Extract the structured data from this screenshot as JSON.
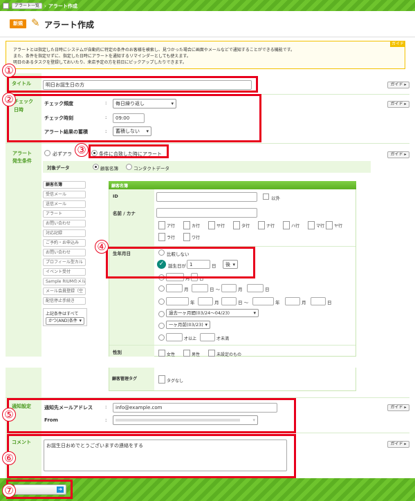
{
  "breadcrumb": {
    "home": "アラート一覧",
    "current": "アラート作成"
  },
  "header": {
    "badge": "新規",
    "title": "アラート作成"
  },
  "info": {
    "guide": "ガイド",
    "lines": [
      "アラートとは指定した日時にシステムが自動的に特定の条件のお客様を検索し、見つかった場合に画面やメールなどで通知することができる機能です。",
      "また、条件を指定せずに、指定した日時にアラートを通知するリマインダーとしても使えます。",
      "明日のあるタスクを登録しておいたり、来店予定の方を前日にピックアップしたりできます。"
    ]
  },
  "guide_label": "ガイド ▸",
  "title_section": {
    "label": "タイトル",
    "value": "明日お誕生日の方"
  },
  "check_section": {
    "label1": "チェック",
    "label2": "日時",
    "freq_label": "チェック頻度",
    "freq_value": "毎日繰り返し",
    "time_label": "チェック時刻",
    "time_value": "09:00",
    "store_label": "アラート結果の蓄積",
    "store_value": "蓄積しない"
  },
  "condition_section": {
    "label1": "アラート",
    "label2": "発生条件",
    "opt_always": "必ずアラ",
    "opt_match": "条件に合致した時にアラート",
    "target_label": "対象データ",
    "target_customer": "顧客名簿",
    "target_contact": "コンタクトデータ",
    "sidebar": [
      "顧客名簿",
      "受信メール",
      "送信メール",
      "アラート",
      "お問い合わせ",
      "対応記録",
      "ご予約・お申込み",
      "お問い合わせ",
      "プロフィール型カル",
      "イベント受付",
      "Sample RIUMのメル",
      "メール会員登録（空",
      "配信停止手続き"
    ],
    "combine_text1": "上記条件はすべて",
    "combine_select": "かつ(AND)条件",
    "panel_title": "顧客名簿",
    "id_label": "ID",
    "id_exclude": "以外",
    "name_label": "名前 / カナ",
    "kana_row1": [
      "ア行",
      "カ行",
      "サ行",
      "タ行",
      "ナ行",
      "ハ行",
      "マ行",
      "ヤ行"
    ],
    "kana_row2": [
      "ラ行",
      "ワ行"
    ],
    "birth_label": "生年月日",
    "birth_none": "比較しない",
    "birth_prefix": "誕生日が",
    "birth_days": "1",
    "birth_day_unit": "日",
    "birth_after": "後",
    "u_month": "月",
    "u_day": "日",
    "u_tilde": "日 ～",
    "u_year": "年",
    "range_past": "過去一ヶ月間(03/24〜04/23)",
    "range_month": "一ヶ月前(03/23)",
    "age_over": "才以上",
    "age_under": "才未満",
    "gender_label": "性別",
    "gender_options": [
      "女性",
      "男性",
      "未設定のもの"
    ],
    "tag_label": "顧客管理タグ",
    "tag_none": "タグなし"
  },
  "notify_section": {
    "label": "通知設定",
    "to_label": "通知先メールアドレス",
    "to_value": "info@example.com",
    "from_label": "From"
  },
  "comment_section": {
    "label": "コメント",
    "value": "お誕生日おめでとうございますの連絡をする"
  },
  "markers": [
    "①",
    "②",
    "③",
    "④",
    "⑤",
    "⑥",
    "⑦"
  ]
}
